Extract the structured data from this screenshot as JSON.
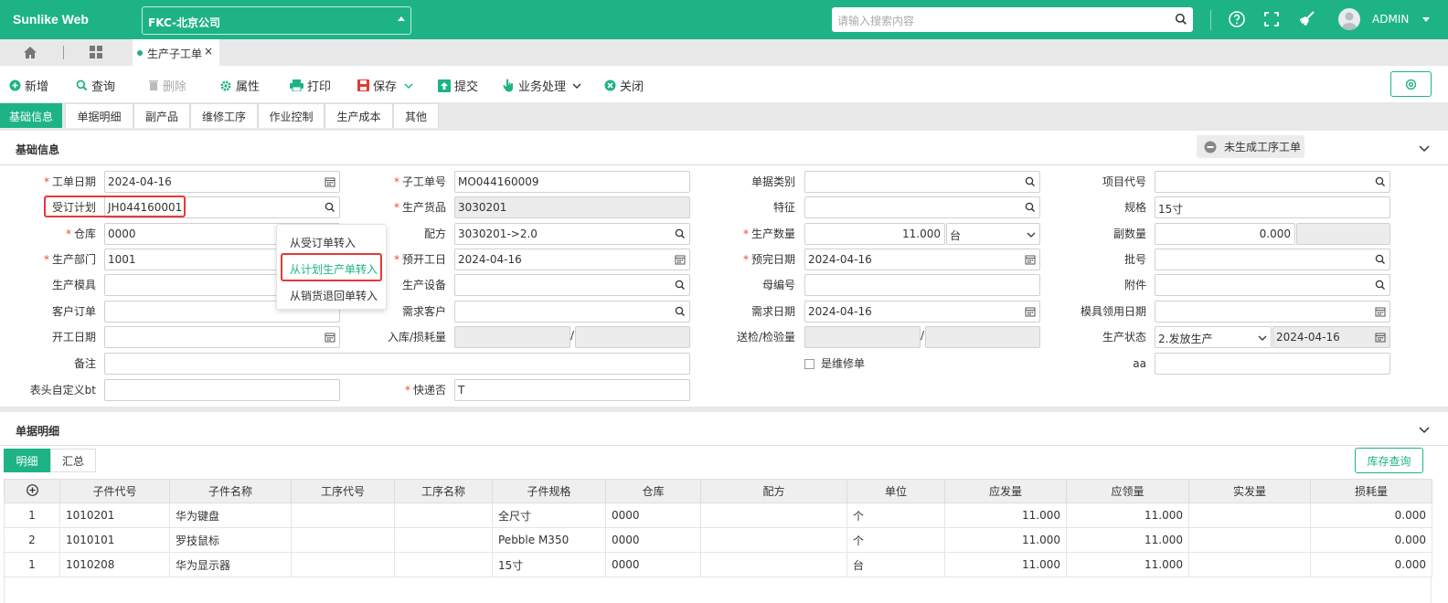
{
  "app": {
    "logo": "Sunlike Web",
    "company": "FKC-北京公司",
    "search_placeholder": "请输入搜索内容",
    "user": "ADMIN"
  },
  "doc_tab": {
    "label": "生产子工单",
    "close": "×"
  },
  "toolbar": {
    "new": "新增",
    "query": "查询",
    "delete": "删除",
    "properties": "属性",
    "print": "打印",
    "save": "保存",
    "submit": "提交",
    "business": "业务处理",
    "close": "关闭"
  },
  "form_tabs": [
    "基础信息",
    "单据明细",
    "副产品",
    "维修工序",
    "作业控制",
    "生产成本",
    "其他"
  ],
  "basic": {
    "title": "基础信息",
    "badge": "未生成工序工单",
    "labels": {
      "order_date": "工单日期",
      "sub_order_no": "子工单号",
      "doc_category": "单据类别",
      "project_code": "项目代号",
      "plan": "受订计划",
      "product": "生产货品",
      "feature": "特征",
      "spec": "规格",
      "warehouse": "仓库",
      "formula": "配方",
      "qty": "生产数量",
      "sub_qty": "副数量",
      "dept": "生产部门",
      "start_plan": "预开工日",
      "finish_plan": "预完日期",
      "batch": "批号",
      "mold": "生产模具",
      "equipment": "生产设备",
      "parent_no": "母编号",
      "attachment": "附件",
      "customer_order": "客户订单",
      "demand_customer": "需求客户",
      "demand_date": "需求日期",
      "mold_date": "模具领用日期",
      "start_date": "开工日期",
      "in_loss": "入库/损耗量",
      "inspect": "送检/检验量",
      "status": "生产状态",
      "remark": "备注",
      "is_repair": "是维修单",
      "aa": "aa",
      "custom_bt": "表头自定义bt",
      "express": "快递否"
    },
    "values": {
      "order_date": "2024-04-16",
      "sub_order_no": "MO044160009",
      "plan": "JH044160001",
      "product": "3030201",
      "spec": "15寸",
      "warehouse": "0000",
      "formula": "3030201->2.0",
      "qty": "11.000",
      "unit": "台",
      "sub_qty": "0.000",
      "dept": "1001",
      "start_plan": "2024-04-16",
      "finish_plan": "2024-04-16",
      "demand_date": "2024-04-16",
      "status": "2.发放生产",
      "status_date": "2024-04-16",
      "express": "T"
    }
  },
  "dropdown": [
    "从受订单转入",
    "从计划生产单转入",
    "从销货退回单转入"
  ],
  "detail": {
    "title": "单据明细",
    "tabs": [
      "明细",
      "汇总"
    ],
    "stock_query": "库存查询",
    "add": "⊕",
    "columns": [
      "子件代号",
      "子件名称",
      "工序代号",
      "工序名称",
      "子件规格",
      "仓库",
      "配方",
      "单位",
      "应发量",
      "应领量",
      "实发量",
      "损耗量"
    ],
    "rows": [
      {
        "seq": "1",
        "code": "1010201",
        "name": "华为键盘",
        "op_code": "",
        "op_name": "",
        "spec": "全尺寸",
        "wh": "0000",
        "formula": "",
        "unit": "个",
        "should_issue": "11.000",
        "should_get": "11.000",
        "actual": "",
        "loss": "0.000"
      },
      {
        "seq": "2",
        "code": "1010101",
        "name": "罗技鼠标",
        "op_code": "",
        "op_name": "",
        "spec": "Pebble M350",
        "wh": "0000",
        "formula": "",
        "unit": "个",
        "should_issue": "11.000",
        "should_get": "11.000",
        "actual": "",
        "loss": "0.000"
      },
      {
        "seq": "1",
        "code": "1010208",
        "name": "华为显示器",
        "op_code": "",
        "op_name": "",
        "spec": "15寸",
        "wh": "0000",
        "formula": "",
        "unit": "台",
        "should_issue": "11.000",
        "should_get": "11.000",
        "actual": "",
        "loss": "0.000"
      }
    ]
  },
  "colors": {
    "accent": "#1db385",
    "highlight": "#e53935",
    "required": "#e74c3c"
  }
}
